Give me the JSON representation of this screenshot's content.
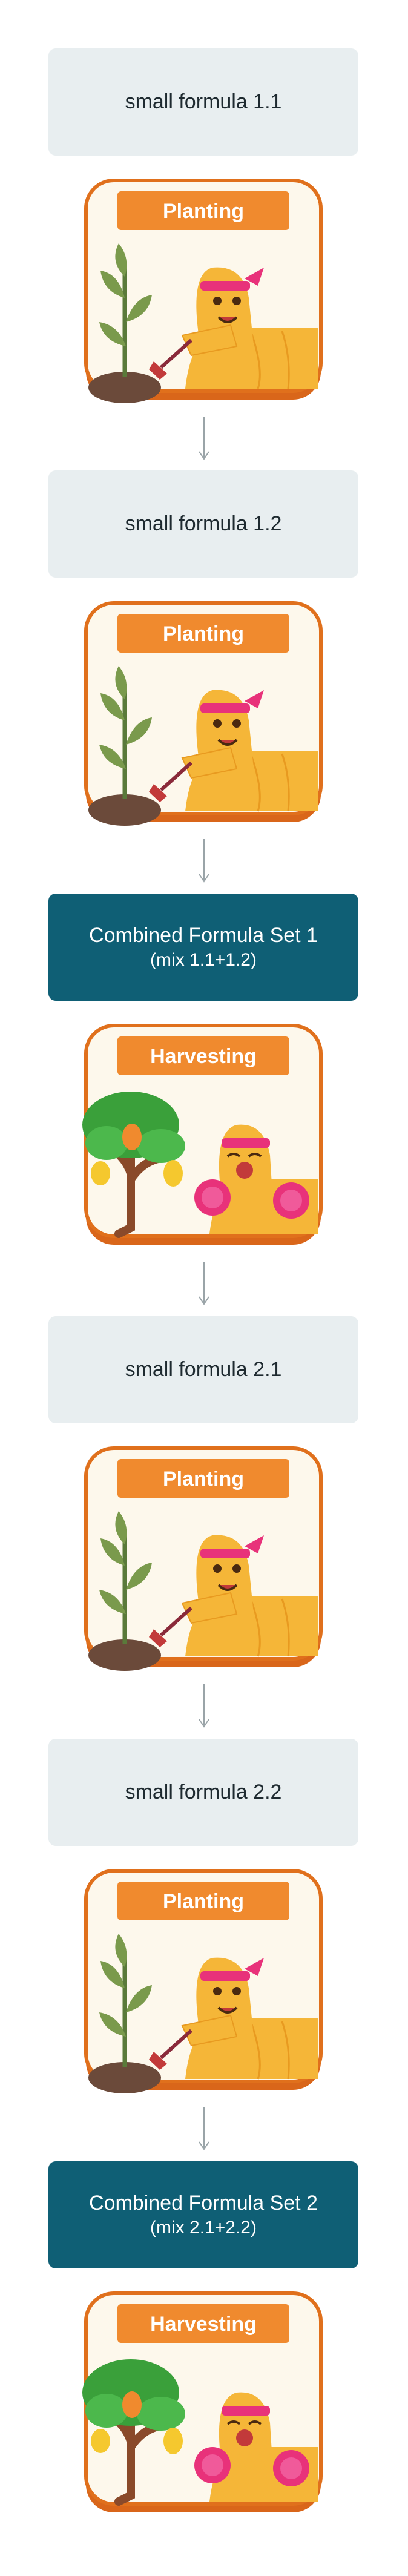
{
  "colors": {
    "small_box_bg": "#e8eef0",
    "combined_box_bg": "#0f5f75",
    "card_border": "#e0701c",
    "banner": "#f08a2e",
    "worm": "#f5b638"
  },
  "steps": [
    {
      "kind": "small",
      "title": "small formula 1.1",
      "subtitle": "",
      "card_label": "Planting",
      "card_icon": "planting-illustration"
    },
    {
      "kind": "small",
      "title": "small formula 1.2",
      "subtitle": "",
      "card_label": "Planting",
      "card_icon": "planting-illustration"
    },
    {
      "kind": "combined",
      "title": "Combined Formula Set 1",
      "subtitle": "(mix 1.1+1.2)",
      "card_label": "Harvesting",
      "card_icon": "harvesting-illustration"
    },
    {
      "kind": "small",
      "title": "small formula 2.1",
      "subtitle": "",
      "card_label": "Planting",
      "card_icon": "planting-illustration"
    },
    {
      "kind": "small",
      "title": "small formula 2.2",
      "subtitle": "",
      "card_label": "Planting",
      "card_icon": "planting-illustration"
    },
    {
      "kind": "combined",
      "title": "Combined Formula Set 2",
      "subtitle": "(mix 2.1+2.2)",
      "card_label": "Harvesting",
      "card_icon": "harvesting-illustration"
    }
  ]
}
